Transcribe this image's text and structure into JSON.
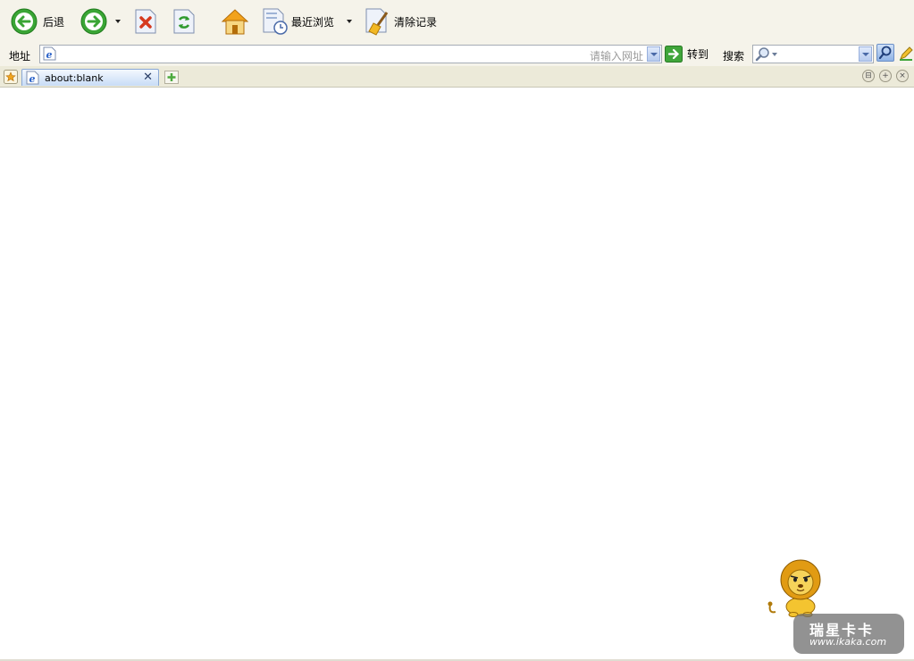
{
  "toolbar": {
    "back_label": "后退",
    "recent_label": "最近浏览",
    "clear_label": "清除记录"
  },
  "address": {
    "label": "地址",
    "value": "",
    "hint": "请输入网址",
    "go_label": "转到"
  },
  "search": {
    "label": "搜索",
    "value": ""
  },
  "tabs": [
    {
      "title": "about:blank"
    }
  ],
  "watermark": {
    "title": "瑞星卡卡",
    "url": "www.ikaka.com"
  },
  "icons": [
    "back-icon",
    "forward-icon",
    "stop-icon",
    "refresh-icon",
    "home-icon",
    "history-icon",
    "broom-icon",
    "ie-page-icon",
    "go-arrow-icon",
    "search-magnifier-icon",
    "pencil-icon",
    "favorites-icon",
    "new-tab-icon",
    "lion-mascot-icon"
  ],
  "colors": {
    "toolbar_bg": "#f5f3ea",
    "tab_active": "#c8dcf6",
    "green_button": "#3fa53a"
  }
}
